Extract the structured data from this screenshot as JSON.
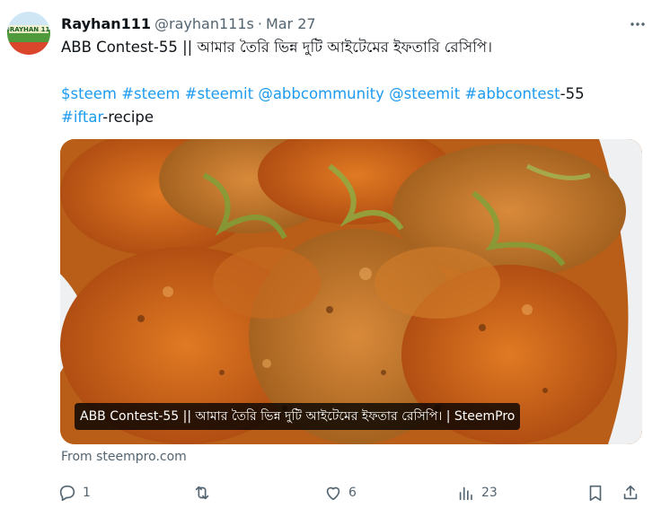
{
  "tweet": {
    "display_name": "Rayhan111",
    "handle": "@rayhan111s",
    "separator": "·",
    "date": "Mar 27",
    "avatar_text": "@RAYHAN 111",
    "text_line1": "ABB Contest-55 || আমার তৈরি ভিন্ন দুটি আইটেমের ইফতারি রেসিপি।",
    "tags": [
      "$steem",
      "#steem",
      "#steemit",
      "@abbcommunity",
      "@steemit",
      "#abbcontest"
    ],
    "tag_suffix": "-55",
    "last_tag": "#iftar",
    "last_suffix": "-recipe"
  },
  "card": {
    "caption": "ABB Contest-55 || আমার তৈরি ভিন্ন দুটি আইটেমের ইফতার রেসিপি। | SteemPro",
    "source": "From steempro.com"
  },
  "actions": {
    "reply_count": "1",
    "repost_count": "",
    "like_count": "6",
    "views_count": "23"
  },
  "colors": {
    "link": "#1d9bf0",
    "muted": "#536471",
    "text": "#0f1419"
  },
  "icons": [
    "more-icon",
    "reply-icon",
    "repost-icon",
    "like-icon",
    "views-icon",
    "bookmark-icon",
    "share-icon"
  ]
}
